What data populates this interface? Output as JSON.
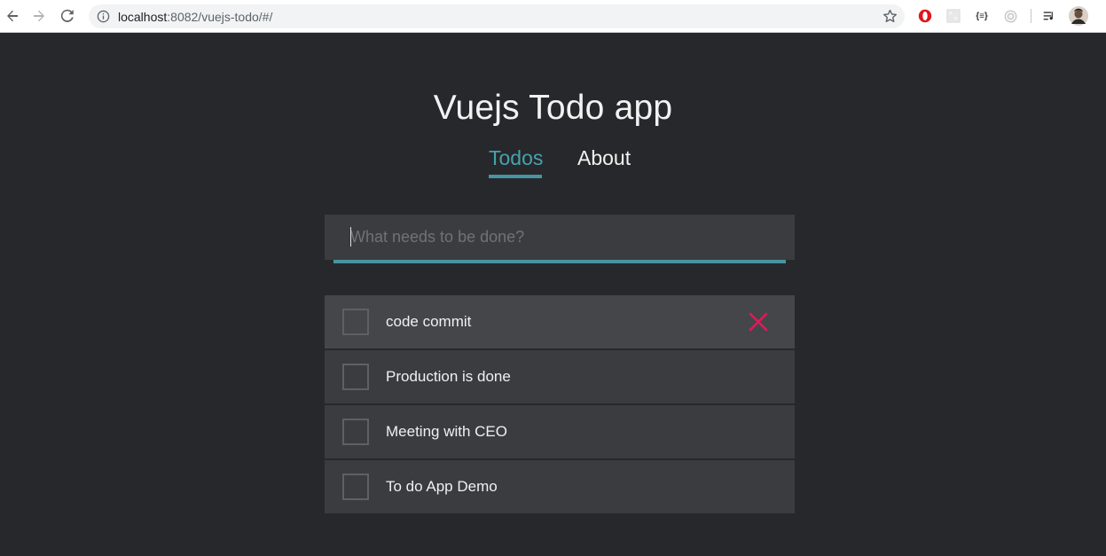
{
  "browser": {
    "url_host": "localhost",
    "url_rest": ":8082/vuejs-todo/#/"
  },
  "app": {
    "title": "Vuejs Todo app",
    "nav": [
      {
        "label": "Todos",
        "active": true
      },
      {
        "label": "About",
        "active": false
      }
    ],
    "input": {
      "placeholder": "What needs to be done?",
      "value": ""
    },
    "todos": [
      {
        "text": "code commit",
        "done": false
      },
      {
        "text": "Production is done",
        "done": false
      },
      {
        "text": "Meeting with CEO",
        "done": false
      },
      {
        "text": "To do App Demo",
        "done": false
      }
    ],
    "colors": {
      "background": "#27282b",
      "accent": "#4695a1",
      "delete": "#e0195a"
    }
  }
}
